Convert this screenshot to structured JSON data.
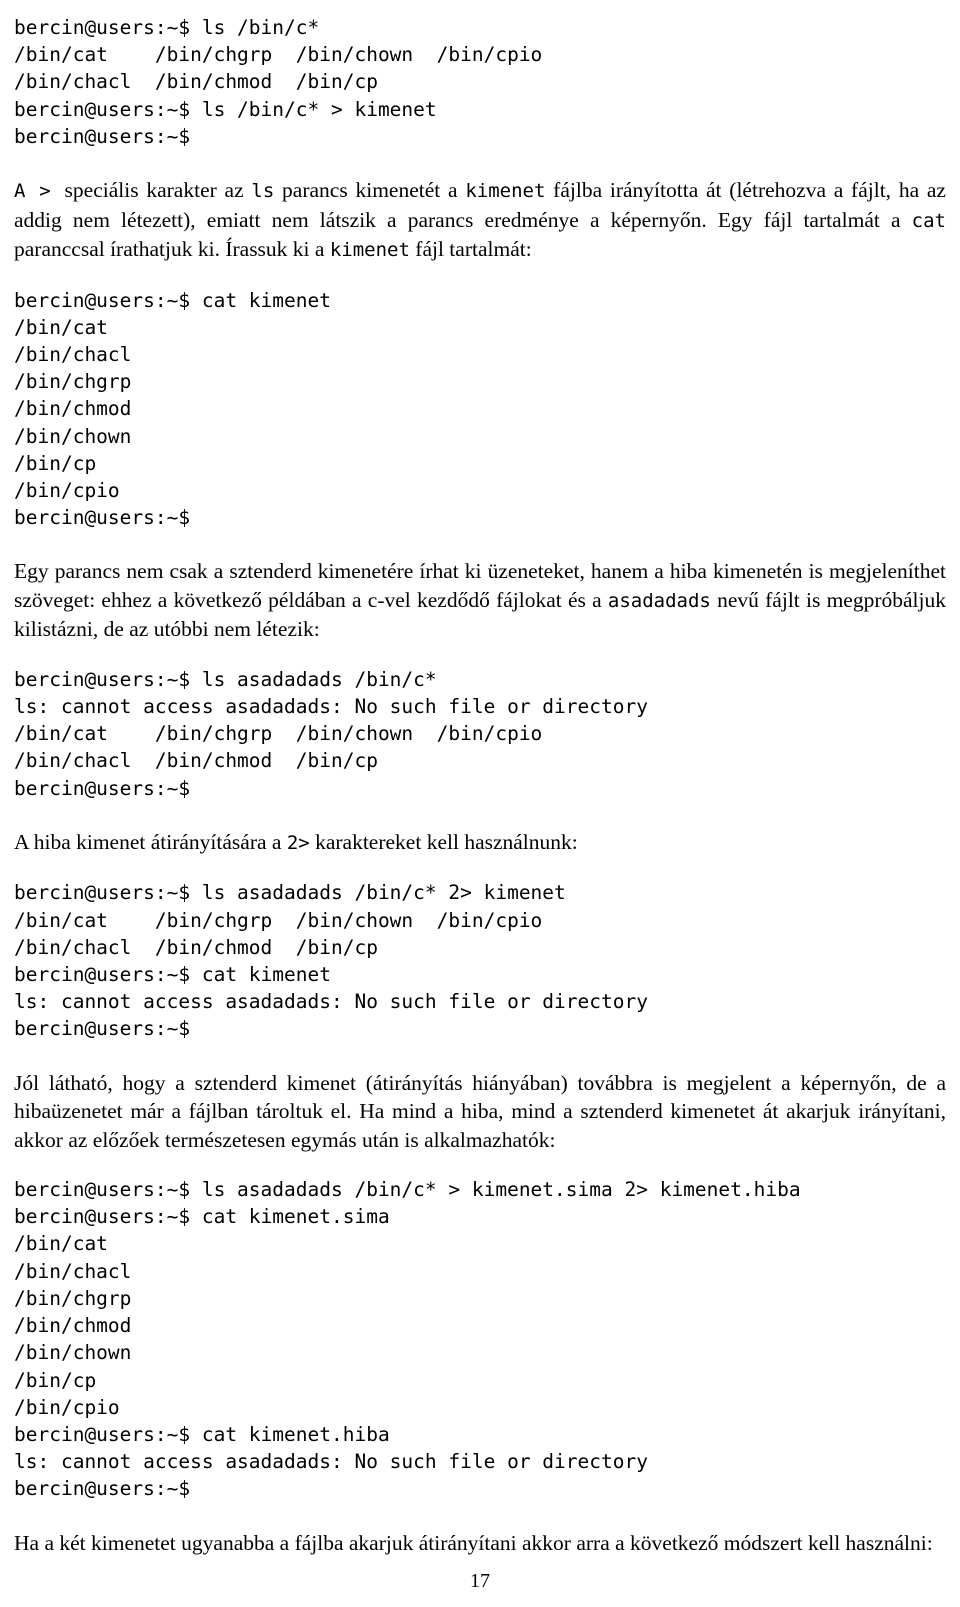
{
  "document": {
    "page_number": "17",
    "blocks": [
      {
        "id": "b1",
        "type": "code",
        "text": "bercin@users:~$ ls /bin/c*\n/bin/cat    /bin/chgrp  /bin/chown  /bin/cpio\n/bin/chacl  /bin/chmod  /bin/cp\nbercin@users:~$ ls /bin/c* > kimenet\nbercin@users:~$"
      },
      {
        "id": "b2",
        "type": "prose",
        "runs": [
          {
            "t": "mono",
            "s": "A > "
          },
          {
            "t": "text",
            "s": "speciális karakter az "
          },
          {
            "t": "mono",
            "s": "ls"
          },
          {
            "t": "text",
            "s": " parancs kimenetét a "
          },
          {
            "t": "mono",
            "s": "kimenet"
          },
          {
            "t": "text",
            "s": " fájlba irányította át (létrehozva a fájlt, ha az addig nem létezett), emiatt nem látszik a parancs eredménye a képernyőn. Egy fájl tartalmát a "
          },
          {
            "t": "mono",
            "s": "cat"
          },
          {
            "t": "text",
            "s": " paranccsal írathatjuk ki. Írassuk ki a "
          },
          {
            "t": "mono",
            "s": "kimenet"
          },
          {
            "t": "text",
            "s": " fájl tartalmát:"
          }
        ]
      },
      {
        "id": "b3",
        "type": "code",
        "text": "bercin@users:~$ cat kimenet\n/bin/cat\n/bin/chacl\n/bin/chgrp\n/bin/chmod\n/bin/chown\n/bin/cp\n/bin/cpio\nbercin@users:~$"
      },
      {
        "id": "b4",
        "type": "prose",
        "runs": [
          {
            "t": "text",
            "s": "Egy parancs nem csak a sztenderd kimenetére írhat ki üzeneteket, hanem a hiba kimenetén is megjeleníthet szöveget: ehhez a következő példában a c-vel kezdődő fájlokat és a "
          },
          {
            "t": "mono",
            "s": "asadadads"
          },
          {
            "t": "text",
            "s": " nevű fájlt is megpróbáljuk kilistázni, de az utóbbi nem létezik:"
          }
        ]
      },
      {
        "id": "b5",
        "type": "code",
        "text": "bercin@users:~$ ls asadadads /bin/c*\nls: cannot access asadadads: No such file or directory\n/bin/cat    /bin/chgrp  /bin/chown  /bin/cpio\n/bin/chacl  /bin/chmod  /bin/cp\nbercin@users:~$"
      },
      {
        "id": "b6",
        "type": "prose",
        "runs": [
          {
            "t": "text",
            "s": "A hiba kimenet átirányítására a "
          },
          {
            "t": "mono",
            "s": "2>"
          },
          {
            "t": "text",
            "s": " karaktereket kell használnunk:"
          }
        ]
      },
      {
        "id": "b7",
        "type": "code",
        "text": "bercin@users:~$ ls asadadads /bin/c* 2> kimenet\n/bin/cat    /bin/chgrp  /bin/chown  /bin/cpio\n/bin/chacl  /bin/chmod  /bin/cp\nbercin@users:~$ cat kimenet\nls: cannot access asadadads: No such file or directory\nbercin@users:~$"
      },
      {
        "id": "b8",
        "type": "prose",
        "runs": [
          {
            "t": "text",
            "s": "Jól látható, hogy a sztenderd kimenet (átirányítás hiányában) továbbra is megjelent a képernyőn, de a hibaüzenetet már a fájlban tároltuk el.  Ha mind a hiba, mind a sztenderd kimenetet át akarjuk irányítani, akkor az előzőek természetesen egymás után is alkalmazhatók:"
          }
        ]
      },
      {
        "id": "b9",
        "type": "code",
        "text": "bercin@users:~$ ls asadadads /bin/c* > kimenet.sima 2> kimenet.hiba\nbercin@users:~$ cat kimenet.sima\n/bin/cat\n/bin/chacl\n/bin/chgrp\n/bin/chmod\n/bin/chown\n/bin/cp\n/bin/cpio\nbercin@users:~$ cat kimenet.hiba\nls: cannot access asadadads: No such file or directory\nbercin@users:~$"
      },
      {
        "id": "b10",
        "type": "prose",
        "runs": [
          {
            "t": "text",
            "s": "Ha a két kimenetet ugyanabba a fájlba akarjuk átirányítani akkor arra a következő módszert kell használni:"
          }
        ]
      }
    ]
  }
}
